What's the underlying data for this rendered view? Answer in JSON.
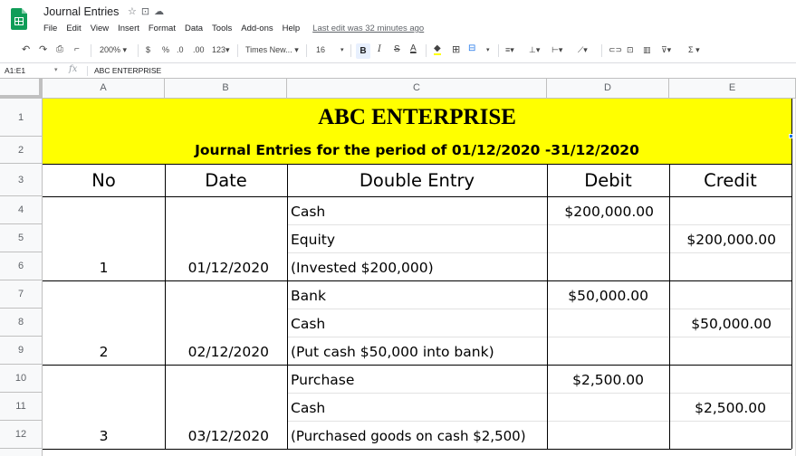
{
  "app": {
    "title": "Journal Entries",
    "title_icons": [
      "star-icon",
      "folder-icon",
      "cloud-icon"
    ],
    "menu": [
      "File",
      "Edit",
      "View",
      "Insert",
      "Format",
      "Data",
      "Tools",
      "Add-ons",
      "Help"
    ],
    "last_edit": "Last edit was 32 minutes ago"
  },
  "toolbar": {
    "zoom": "200%",
    "currency": "$",
    "percent": "%",
    "decimal_decrease": ".0",
    "decimal_increase": ".00",
    "more_formats": "123",
    "font": "Times New...",
    "font_size": "16",
    "bold": "B",
    "italic": "I",
    "strike": "S",
    "text_color": "A"
  },
  "formula_bar": {
    "name_box": "A1:E1",
    "fx": "fx",
    "content": "ABC ENTERPRISE"
  },
  "columns": [
    "A",
    "B",
    "C",
    "D",
    "E"
  ],
  "rows": [
    "1",
    "2",
    "3",
    "4",
    "5",
    "6",
    "7",
    "8",
    "9",
    "10",
    "11",
    "12"
  ],
  "sheet": {
    "title": "ABC ENTERPRISE",
    "subtitle": "Journal Entries for the period of 01/12/2020 -31/12/2020",
    "headers": {
      "no": "No",
      "date": "Date",
      "double_entry": "Double Entry",
      "debit": "Debit",
      "credit": "Credit"
    },
    "entries": [
      {
        "no": "1",
        "date": "01/12/2020",
        "lines": [
          {
            "account": "Cash",
            "debit": "$200,000.00",
            "credit": ""
          },
          {
            "account": "Equity",
            "debit": "",
            "credit": "$200,000.00"
          },
          {
            "account": "(Invested $200,000)",
            "debit": "",
            "credit": ""
          }
        ]
      },
      {
        "no": "2",
        "date": "02/12/2020",
        "lines": [
          {
            "account": "Bank",
            "debit": "$50,000.00",
            "credit": ""
          },
          {
            "account": "Cash",
            "debit": "",
            "credit": "$50,000.00"
          },
          {
            "account": "(Put cash $50,000 into bank)",
            "debit": "",
            "credit": ""
          }
        ]
      },
      {
        "no": "3",
        "date": "03/12/2020",
        "lines": [
          {
            "account": "Purchase",
            "debit": "$2,500.00",
            "credit": ""
          },
          {
            "account": "Cash",
            "debit": "",
            "credit": "$2,500.00"
          },
          {
            "account": "(Purchased goods on cash $2,500)",
            "debit": "",
            "credit": ""
          }
        ]
      }
    ]
  },
  "colors": {
    "band": "#ffff00",
    "sheets_green": "#0f9d58",
    "selection": "#1a73e8"
  }
}
